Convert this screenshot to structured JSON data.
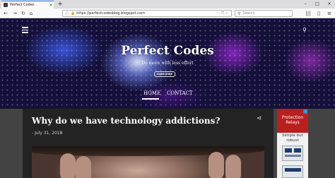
{
  "browser": {
    "tab_title": "Perfect Codes",
    "tab_close": "×",
    "new_tab": "+",
    "url": "https://perfectcodesblog.blogspot.com",
    "url_actions": "··· ⛉ ☆",
    "search_placeholder": "Search",
    "back": "←",
    "forward": "→",
    "reload": "↻",
    "home": "⌂",
    "library": "|||",
    "sidebar": "▯",
    "menu": "≡",
    "minimize": "–",
    "maximize": "□",
    "close": "×"
  },
  "header": {
    "title": "Perfect Codes",
    "tagline": "Do more with less effort",
    "subscribe_label": "SUBSCRIBE",
    "search_icon": "⚲",
    "nav": [
      {
        "label": "HOME",
        "active": true
      },
      {
        "label": "CONTACT",
        "active": false
      }
    ]
  },
  "post": {
    "title": "Why do we have technology addictions?",
    "date": "- July 31, 2018",
    "share_icon": "share-icon"
  },
  "ad": {
    "headline": "Protection Relays",
    "subline": "Simple but robust",
    "info": "i"
  },
  "colors": {
    "chrome_bg": "#f9f9fa",
    "post_bg": "#232323",
    "ad_red": "#b81f1f",
    "accent": "#0a84ff"
  }
}
